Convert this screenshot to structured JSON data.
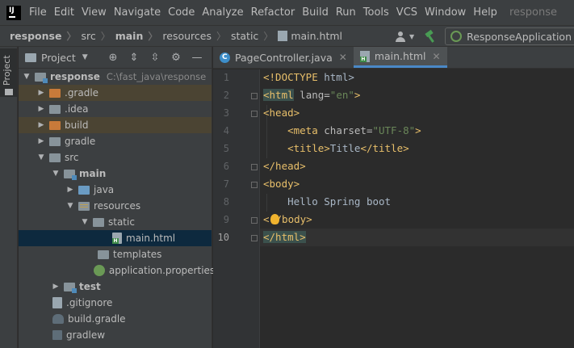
{
  "menu": {
    "items": [
      "File",
      "Edit",
      "View",
      "Navigate",
      "Code",
      "Analyze",
      "Refactor",
      "Build",
      "Run",
      "Tools",
      "VCS",
      "Window",
      "Help"
    ],
    "project_name": "response"
  },
  "breadcrumbs": {
    "items": [
      "response",
      "src",
      "main",
      "resources",
      "static",
      "main.html"
    ]
  },
  "run_config": {
    "label": "ResponseApplication"
  },
  "tool_stripe": {
    "project_label": "Project"
  },
  "project_panel": {
    "title": "Project",
    "tree": [
      {
        "label": "response",
        "path": "C:\\fast_java\\response"
      },
      {
        "label": ".gradle"
      },
      {
        "label": ".idea"
      },
      {
        "label": "build"
      },
      {
        "label": "gradle"
      },
      {
        "label": "src"
      },
      {
        "label": "main"
      },
      {
        "label": "java"
      },
      {
        "label": "resources"
      },
      {
        "label": "static"
      },
      {
        "label": "main.html"
      },
      {
        "label": "templates"
      },
      {
        "label": "application.properties"
      },
      {
        "label": "test"
      },
      {
        "label": ".gitignore"
      },
      {
        "label": "build.gradle"
      },
      {
        "label": "gradlew"
      }
    ]
  },
  "editor_tabs": [
    {
      "label": "PageController.java",
      "icon": "java-class-icon"
    },
    {
      "label": "main.html",
      "icon": "html-file-icon",
      "active": true
    }
  ],
  "editor": {
    "line_numbers": [
      "1",
      "2",
      "3",
      "4",
      "5",
      "6",
      "7",
      "8",
      "9",
      "10"
    ],
    "current_line": 10,
    "lines": {
      "l1": {
        "open": "<!DOCTYPE",
        "rest": " html>"
      },
      "l2": {
        "open": "<html",
        "attr": " lang=",
        "val": "\"en\"",
        "close": ">"
      },
      "l3": {
        "tag": "<head>"
      },
      "l4": {
        "indent": "    ",
        "open": "<meta",
        "attr": " charset=",
        "val": "\"UTF-8\"",
        "close": ">"
      },
      "l5": {
        "indent": "    ",
        "open": "<title>",
        "text": "Title",
        "close": "</title>"
      },
      "l6": {
        "tag": "</head>"
      },
      "l7": {
        "tag": "<body>"
      },
      "l8": {
        "indent": "    ",
        "text": "Hello Spring boot"
      },
      "l9": {
        "open": "<",
        "rest": "/body>"
      },
      "l10": {
        "tag": "</html>"
      }
    }
  },
  "colors": {
    "tag": "#e8bf6a",
    "attr_value": "#6a8759",
    "text": "#a9b7c6",
    "selection": "#0d293e",
    "highlight_folder": "#4b4433"
  }
}
